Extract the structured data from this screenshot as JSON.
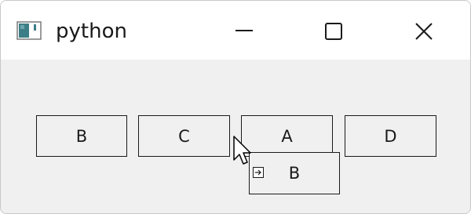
{
  "window": {
    "title": "python",
    "controls": {
      "minimize": "minimize-icon",
      "maximize": "maximize-icon",
      "close": "close-icon"
    }
  },
  "buttons": [
    {
      "label": "B"
    },
    {
      "label": "C"
    },
    {
      "label": "A"
    },
    {
      "label": "D"
    }
  ],
  "drag": {
    "label": "B",
    "cursor_icon": "arrow-cursor-icon",
    "drop_icon": "drag-copy-icon"
  }
}
